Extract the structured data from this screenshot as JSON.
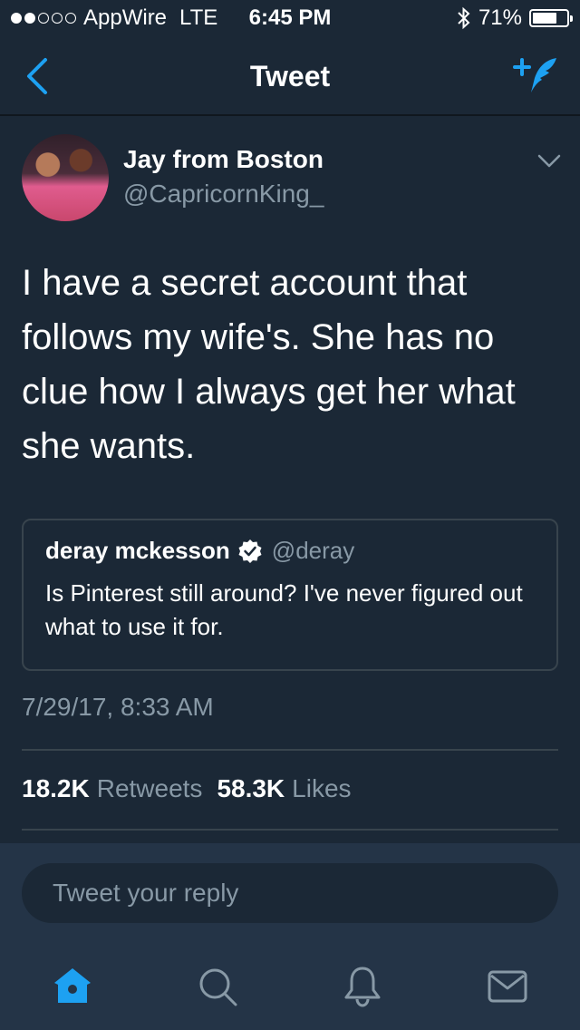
{
  "status_bar": {
    "carrier": "AppWire",
    "network": "LTE",
    "time": "6:45 PM",
    "battery_percent": "71%",
    "battery_level": 0.71,
    "signal_bars_filled": 2,
    "signal_bars_total": 5
  },
  "nav": {
    "title": "Tweet",
    "back_icon": "chevron-left-icon",
    "compose_icon": "compose-tweet-icon"
  },
  "tweet": {
    "author_name": "Jay from Boston",
    "author_handle": "@CapricornKing_",
    "text": "I have a secret account that follows my wife's. She has no clue how I always get her what she wants.",
    "timestamp": "7/29/17, 8:33 AM",
    "retweets_count": "18.2K",
    "retweets_label": "Retweets",
    "likes_count": "58.3K",
    "likes_label": "Likes"
  },
  "quoted_tweet": {
    "author_name": "deray mckesson",
    "author_handle": "@deray",
    "verified": true,
    "text": "Is Pinterest still around? I've never figured out what to use it for."
  },
  "reply": {
    "placeholder": "Tweet your reply"
  },
  "tab_bar": {
    "items": [
      "home-icon",
      "search-icon",
      "notifications-icon",
      "messages-icon"
    ],
    "active": "home-icon"
  },
  "colors": {
    "background": "#1b2836",
    "secondary_text": "#8899a6",
    "accent": "#1da1f2",
    "divider": "#38444d",
    "bar_background": "#243447"
  }
}
